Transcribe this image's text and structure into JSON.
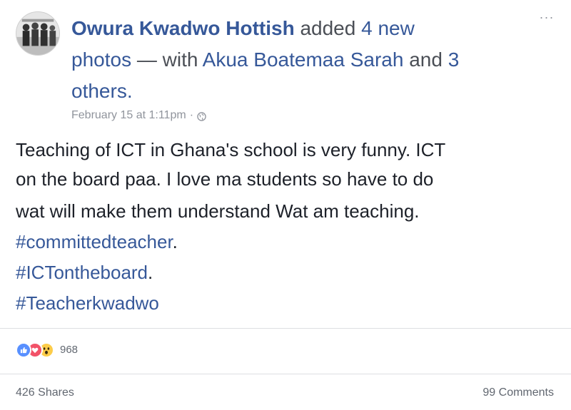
{
  "post": {
    "author": "Owura Kwadwo Hottish",
    "action_added": "added",
    "photo_link": "4 new",
    "photo_word": "photos",
    "with_text": "— with",
    "tagged_person": "Akua Boatemaa Sarah",
    "and_text": "and",
    "others_link_num": "3",
    "others_link_word": "others.",
    "timestamp": "February 15 at 1:11pm",
    "separator": "·",
    "privacy_icon": "globe-icon",
    "more_options": "···",
    "body_lines": [
      "Teaching of ICT in Ghana's school is very funny. ICT",
      "on the board paa. I love ma students so have to do",
      "wat will make them understand Wat am teaching."
    ],
    "hashtags": [
      {
        "tag": "#committedteacher",
        "suffix": "."
      },
      {
        "tag": "#ICTontheboard",
        "suffix": "."
      },
      {
        "tag": "#Teacherkwadwo",
        "suffix": ""
      }
    ]
  },
  "reactions": {
    "icons": [
      "like-icon",
      "love-icon",
      "wow-icon"
    ],
    "count": "968"
  },
  "footer": {
    "shares": "426 Shares",
    "comments": "99 Comments"
  },
  "colors": {
    "link": "#365899",
    "secondary_text": "#90949c",
    "body_text": "#1d2129",
    "like_blue": "#5890ff",
    "love_red": "#f25268",
    "wow_yellow": "#fccc49"
  }
}
